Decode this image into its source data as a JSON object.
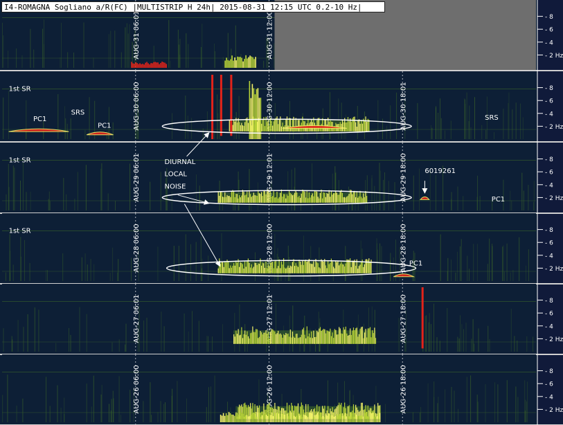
{
  "chart_data": {
    "type": "heatmap",
    "title": "I4-ROMAGNA Sogliano a/R(FC) |MULTISTRIP H 24h| 2015-08-31 12:15 UTC 0.2-10 Hz|",
    "xlabel": "",
    "ylabel": "",
    "colors": {
      "background": "#0d1f36",
      "signal_low": "#3f6b28",
      "signal_mid": "#b9d437",
      "signal_high": "#f4f36a",
      "event": "#e2231a",
      "empty_area": "#6e6e6e",
      "scale_panel": "#101a3a",
      "annotation": "#ffffff"
    },
    "frequency_ticks": [
      {
        "value": 8,
        "label": "8"
      },
      {
        "value": 6,
        "label": "6"
      },
      {
        "value": 4,
        "label": "4"
      },
      {
        "value": 2,
        "label": "2 Hz"
      }
    ],
    "ylim": [
      0,
      10
    ],
    "xlim_hours": [
      0,
      24
    ],
    "strips": [
      {
        "date_tag": "AUG-31",
        "time_markers": [
          {
            "hour": 6,
            "label": "AUG-31 06:01"
          },
          {
            "hour": 12,
            "label": "AUG-31 12:00"
          }
        ],
        "data_until_hour": 12.25
      },
      {
        "date_tag": "AUG-30",
        "time_markers": [
          {
            "hour": 6,
            "label": "AUG-30 06:00"
          },
          {
            "hour": 12,
            "label": "AUG-30 12:00"
          },
          {
            "hour": 18,
            "label": "AUG-30 18:01"
          }
        ]
      },
      {
        "date_tag": "AUG-29",
        "time_markers": [
          {
            "hour": 6,
            "label": "AUG-29 06:01"
          },
          {
            "hour": 12,
            "label": "AUG-29 12:01"
          },
          {
            "hour": 18,
            "label": "AUG-29 18:00"
          }
        ]
      },
      {
        "date_tag": "AUG-28",
        "time_markers": [
          {
            "hour": 6,
            "label": "AUG-28 06:00"
          },
          {
            "hour": 12,
            "label": "AUG-28 12:00"
          },
          {
            "hour": 18,
            "label": "AUG-28 18:00"
          }
        ]
      },
      {
        "date_tag": "AUG-27",
        "time_markers": [
          {
            "hour": 6,
            "label": "AUG-27 06:01"
          },
          {
            "hour": 12,
            "label": "AUG-27 12:01"
          },
          {
            "hour": 18,
            "label": "AUG-27 18:00"
          }
        ]
      },
      {
        "date_tag": "AUG-26",
        "time_markers": [
          {
            "hour": 6,
            "label": "AUG-26 06:00"
          },
          {
            "hour": 12,
            "label": "AUG-26 12:00"
          },
          {
            "hour": 18,
            "label": "AUG-26 18:00"
          }
        ]
      }
    ],
    "noise_bands": [
      {
        "strip": 1,
        "start_hour": 10.2,
        "end_hour": 16.5,
        "freq_low": 1.2,
        "freq_high": 3.0
      },
      {
        "strip": 2,
        "start_hour": 9.7,
        "end_hour": 16.4,
        "freq_low": 1.2,
        "freq_high": 2.8
      },
      {
        "strip": 3,
        "start_hour": 9.7,
        "end_hour": 16.6,
        "freq_low": 1.2,
        "freq_high": 3.0
      },
      {
        "strip": 4,
        "start_hour": 10.4,
        "end_hour": 16.8,
        "freq_low": 1.2,
        "freq_high": 3.3
      },
      {
        "strip": 5,
        "start_hour": 10.5,
        "end_hour": 17.0,
        "freq_low": 0.5,
        "freq_high": 2.5
      }
    ],
    "ellipses": [
      {
        "strip": 1,
        "center_hour": 12.8,
        "center_freq": 2.0,
        "half_width_hours": 5.6,
        "half_height_freq": 1.1
      },
      {
        "strip": 2,
        "center_hour": 12.8,
        "center_freq": 2.0,
        "half_width_hours": 5.6,
        "half_height_freq": 1.1
      },
      {
        "strip": 3,
        "center_hour": 13.0,
        "center_freq": 2.0,
        "half_width_hours": 5.6,
        "half_height_freq": 1.2
      }
    ],
    "bright_bursts": [
      {
        "strip": 0,
        "start_hour": 10.0,
        "end_hour": 11.4,
        "freq_high": 2.0
      },
      {
        "strip": 0,
        "start_hour": 5.8,
        "end_hour": 7.4,
        "freq_high": 1.0,
        "color": "event"
      },
      {
        "strip": 1,
        "start_hour": 11.1,
        "end_hour": 11.6,
        "freq_high": 10.0
      },
      {
        "strip": 5,
        "start_hour": 9.8,
        "end_hour": 17.0,
        "freq_high": 1.6
      }
    ],
    "event_lines": [
      {
        "strip": 1,
        "hour": 9.45,
        "freq_low": 0.0,
        "freq_high": 10.0
      },
      {
        "strip": 1,
        "hour": 9.85,
        "freq_low": 0.5,
        "freq_high": 10.0
      },
      {
        "strip": 1,
        "hour": 10.3,
        "freq_low": 0.5,
        "freq_high": 10.0
      },
      {
        "strip": 4,
        "hour": 18.9,
        "freq_low": 0.5,
        "freq_high": 10.0
      }
    ],
    "pc1_events": [
      {
        "strip": 1,
        "start_hour": 0.3,
        "end_hour": 3.0,
        "freq": 1.5
      },
      {
        "strip": 1,
        "start_hour": 3.8,
        "end_hour": 5.0,
        "freq": 1.0
      },
      {
        "strip": 1,
        "start_hour": 12.6,
        "end_hour": 15.5,
        "freq": 2.0
      },
      {
        "strip": 2,
        "start_hour": 18.8,
        "end_hour": 19.2,
        "freq": 2.0
      },
      {
        "strip": 3,
        "start_hour": 17.6,
        "end_hour": 18.5,
        "freq": 1.0
      }
    ],
    "annotations": [
      {
        "id": "sr-1",
        "text": "1st SR",
        "strip": 1,
        "hour": 0.3,
        "freq": 7.5
      },
      {
        "id": "pc1-a",
        "text": "PC1",
        "strip": 1,
        "hour": 1.4,
        "freq": 2.8
      },
      {
        "id": "srs-a",
        "text": "SRS",
        "strip": 1,
        "hour": 3.1,
        "freq": 3.8
      },
      {
        "id": "pc1-b",
        "text": "PC1",
        "strip": 1,
        "hour": 4.3,
        "freq": 1.8
      },
      {
        "id": "srs-b",
        "text": "SRS",
        "strip": 1,
        "hour": 21.7,
        "freq": 3.0
      },
      {
        "id": "sr-2",
        "text": "1st SR",
        "strip": 2,
        "hour": 0.3,
        "freq": 7.5
      },
      {
        "id": "noise-1",
        "text": "DIURNAL",
        "strip": 2,
        "hour": 7.3,
        "freq": 7.2
      },
      {
        "id": "noise-2",
        "text": "LOCAL",
        "strip": 2,
        "hour": 7.3,
        "freq": 5.3
      },
      {
        "id": "noise-3",
        "text": "NOISE",
        "strip": 2,
        "hour": 7.3,
        "freq": 3.4
      },
      {
        "id": "event-id",
        "text": "6019261",
        "strip": 2,
        "hour": 19.0,
        "freq": 5.8
      },
      {
        "id": "pc1-c",
        "text": "PC1",
        "strip": 2,
        "hour": 22.0,
        "freq": 1.4
      },
      {
        "id": "sr-3",
        "text": "1st SR",
        "strip": 3,
        "hour": 0.3,
        "freq": 7.5
      },
      {
        "id": "pc1-d",
        "text": "PC1",
        "strip": 3,
        "hour": 18.3,
        "freq": 2.4
      }
    ],
    "arrows": [
      {
        "from": {
          "strip": 2,
          "hour": 8.3,
          "freq": 8.4
        },
        "to": {
          "strip": 1,
          "hour": 9.3,
          "freq": 1.0
        }
      },
      {
        "from": {
          "strip": 2,
          "hour": 7.9,
          "freq": 2.4
        },
        "to": {
          "strip": 2,
          "hour": 9.3,
          "freq": 1.1
        }
      },
      {
        "from": {
          "strip": 2,
          "hour": 8.2,
          "freq": 1.0
        },
        "to": {
          "strip": 3,
          "hour": 9.8,
          "freq": 2.3
        }
      },
      {
        "from": {
          "strip": 2,
          "hour": 19.0,
          "freq": 4.6
        },
        "to": {
          "strip": 2,
          "hour": 19.0,
          "freq": 2.7
        }
      }
    ],
    "grid": true,
    "legend": "none"
  }
}
